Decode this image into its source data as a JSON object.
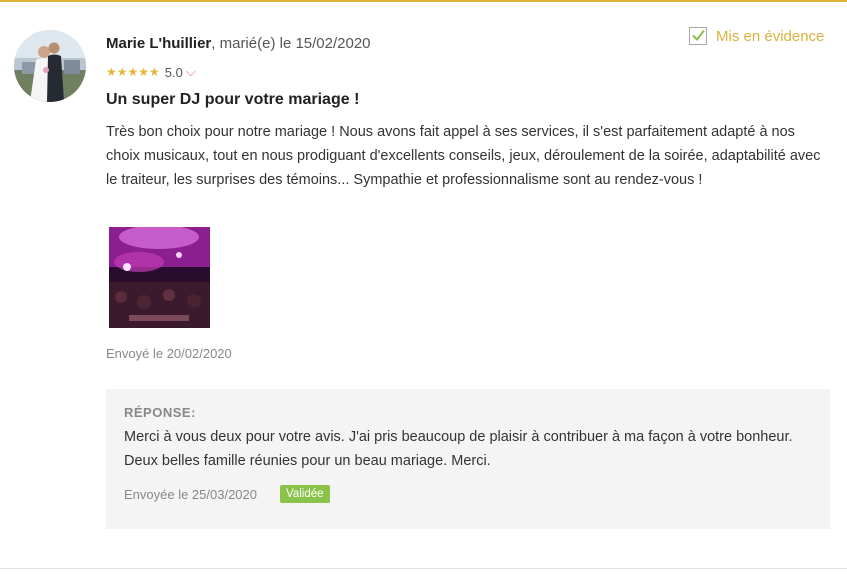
{
  "review": {
    "author_name": "Marie L'huillier",
    "author_meta": ", marié(e) le 15/02/2020",
    "rating_stars": "★★★★★",
    "rating_value": "5.0",
    "chevron": "⌵",
    "featured_label": "Mis en évidence",
    "featured_checked": true,
    "title": "Un super DJ pour votre mariage !",
    "body": "Très bon choix pour notre mariage ! Nous avons fait appel à ses services, il s'est parfaitement adapté à nos choix musicaux, tout en nous prodiguant d'excellents conseils, jeux, déroulement de la soirée, adaptabilité avec le traiteur, les surprises des témoins... Sympathie et professionnalisme sont au rendez-vous !",
    "sent_date": "Envoyé le 20/02/2020"
  },
  "response": {
    "label": "RÉPONSE:",
    "text": "Merci à vous deux pour votre avis. J'ai pris beaucoup de plaisir à contribuer à ma façon à votre bonheur. Deux belles famille réunies pour un beau mariage. Merci.",
    "sent_date": "Envoyée le 25/03/2020",
    "status": "Validée"
  },
  "colors": {
    "accent": "#d9b23b",
    "star": "#e2b73a",
    "status_badge": "#8bc34a",
    "response_bg": "#f4f4f4"
  },
  "icons": {
    "featured": "checkmark-icon",
    "rating_toggle": "chevron-down-icon"
  }
}
